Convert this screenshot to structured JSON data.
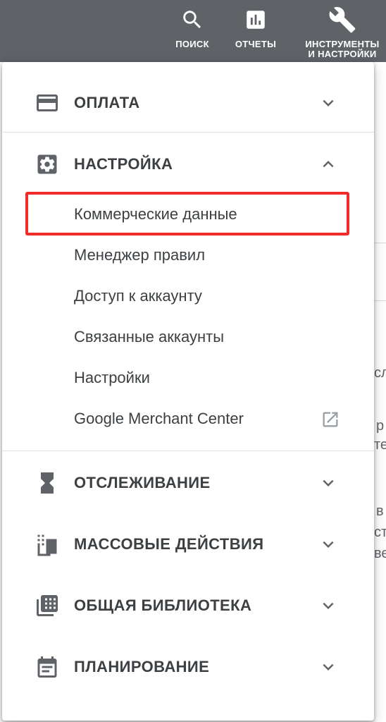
{
  "topbar": {
    "search_label": "ПОИСК",
    "reports_label": "ОТЧЕТЫ",
    "tools_label_line1": "ИНСТРУМЕНТЫ",
    "tools_label_line2": "И НАСТРОЙКИ"
  },
  "background": {
    "fragments": [
      "сл",
      "р",
      "те",
      "в",
      "ст",
      "ве"
    ]
  },
  "menu": {
    "billing": {
      "title": "ОПЛАТА",
      "icon": "credit-card-icon",
      "expanded": false
    },
    "setup": {
      "title": "НАСТРОЙКА",
      "icon": "gear-icon",
      "expanded": true,
      "items": [
        {
          "label": "Коммерческие данные",
          "highlighted": true
        },
        {
          "label": "Менеджер правил"
        },
        {
          "label": "Доступ к аккаунту"
        },
        {
          "label": "Связанные аккаунты"
        },
        {
          "label": "Настройки"
        },
        {
          "label": "Google Merchant Center",
          "icon": "open-in-new-icon"
        }
      ]
    },
    "measurement": {
      "title": "ОТСЛЕЖИВАНИЕ",
      "icon": "hourglass-icon",
      "expanded": false
    },
    "bulk_actions": {
      "title": "МАССОВЫЕ ДЕЙСТВИЯ",
      "icon": "copies-icon",
      "expanded": false
    },
    "shared_library": {
      "title": "ОБЩАЯ БИБЛИОТЕКА",
      "icon": "library-icon",
      "expanded": false
    },
    "planning": {
      "title": "ПЛАНИРОВАНИЕ",
      "icon": "calendar-icon",
      "expanded": false
    }
  },
  "colors": {
    "topbar": "#5f6368",
    "highlight_border": "#f22b2b",
    "text": "#3c4043",
    "icon": "#5f6368"
  }
}
